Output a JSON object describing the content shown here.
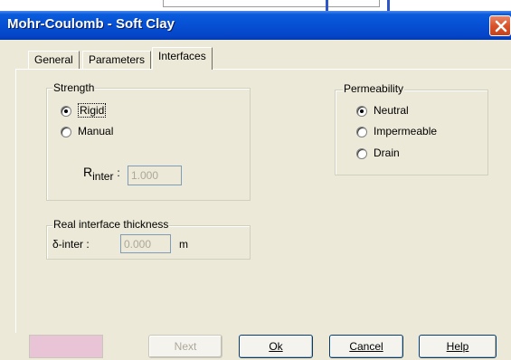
{
  "window": {
    "title": "Mohr-Coulomb - Soft Clay"
  },
  "tabs": [
    {
      "label": "General",
      "active": false
    },
    {
      "label": "Parameters",
      "active": false
    },
    {
      "label": "Interfaces",
      "active": true
    }
  ],
  "strength": {
    "legend": "Strength",
    "options": [
      {
        "label": "Rigid",
        "checked": true
      },
      {
        "label": "Manual",
        "checked": false
      }
    ],
    "rinter_label_main": "R",
    "rinter_label_sub": "inter",
    "rinter_colon": ":",
    "rinter_value": "1.000"
  },
  "permeability": {
    "legend": "Permeability",
    "options": [
      {
        "label": "Neutral",
        "checked": true
      },
      {
        "label": "Impermeable",
        "checked": false
      },
      {
        "label": "Drain",
        "checked": false
      }
    ]
  },
  "thickness": {
    "legend": "Real interface thickness",
    "field_label": "δ-inter :",
    "value": "0.000",
    "unit": "m"
  },
  "buttons": {
    "next": "Next",
    "ok": "Ok",
    "cancel": "Cancel",
    "help": "Help"
  },
  "colors": {
    "swatch": "#e8c4d6",
    "titlebar": "#0650d4"
  }
}
